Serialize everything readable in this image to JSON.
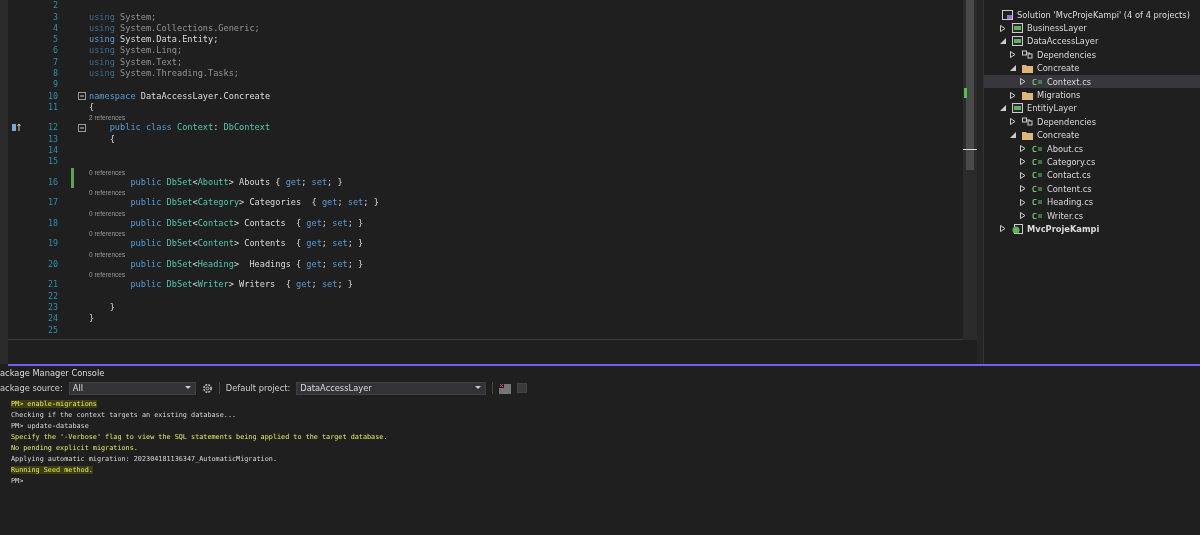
{
  "editor": {
    "lines": [
      {
        "number": "2"
      },
      {
        "number": "3",
        "dimmed": true,
        "changed": false,
        "tokens": [
          {
            "kind": "keyword",
            "text": "using"
          },
          {
            "kind": "plain",
            "text": " System;"
          }
        ]
      },
      {
        "number": "4",
        "dimmed": true,
        "changed": false,
        "tokens": [
          {
            "kind": "keyword",
            "text": "using"
          },
          {
            "kind": "plain",
            "text": " System.Collections.Generic;"
          }
        ]
      },
      {
        "number": "5",
        "dimmed": false,
        "changed": false,
        "tokens": [
          {
            "kind": "keyword",
            "text": "using"
          },
          {
            "kind": "plain",
            "text": " System.Data.Entity;"
          }
        ]
      },
      {
        "number": "6",
        "dimmed": true,
        "changed": false,
        "tokens": [
          {
            "kind": "keyword",
            "text": "using"
          },
          {
            "kind": "plain",
            "text": " System.Linq;"
          }
        ]
      },
      {
        "number": "7",
        "dimmed": true,
        "changed": false,
        "tokens": [
          {
            "kind": "keyword",
            "text": "using"
          },
          {
            "kind": "plain",
            "text": " System.Text;"
          }
        ]
      },
      {
        "number": "8",
        "dimmed": true,
        "changed": false,
        "tokens": [
          {
            "kind": "keyword",
            "text": "using"
          },
          {
            "kind": "plain",
            "text": " System.Threading.Tasks;"
          }
        ]
      },
      {
        "number": "9"
      },
      {
        "number": "10",
        "dimmed": false,
        "changed": false,
        "fold": true,
        "tokens": [
          {
            "kind": "keyword",
            "text": "namespace"
          },
          {
            "kind": "plain",
            "text": " DataAccessLayer.Concreate"
          }
        ]
      },
      {
        "number": "11",
        "dimmed": false,
        "changed": false,
        "tokens": [
          {
            "kind": "plain",
            "text": "{"
          }
        ]
      },
      {
        "number": "12",
        "dimmed": false,
        "changed": false,
        "fold": true,
        "override": true,
        "hint": "2 references",
        "tokens": [
          {
            "kind": "keyword",
            "text": "    public class"
          },
          {
            "kind": "type",
            "text": " Context"
          },
          {
            "kind": "plain",
            "text": ": "
          },
          {
            "kind": "type",
            "text": "DbContext"
          }
        ]
      },
      {
        "number": "13",
        "dimmed": false,
        "changed": false,
        "tokens": [
          {
            "kind": "plain",
            "text": "    {"
          }
        ]
      },
      {
        "number": "14"
      },
      {
        "number": "15"
      },
      {
        "number": "16",
        "dimmed": false,
        "changed": true,
        "hint": "0 references",
        "tokens": [
          {
            "kind": "keyword",
            "text": "        public"
          },
          {
            "kind": "type",
            "text": " DbSet"
          },
          {
            "kind": "plain",
            "text": "<"
          },
          {
            "kind": "type",
            "text": "Aboutt"
          },
          {
            "kind": "plain",
            "text": "> Abouts { "
          },
          {
            "kind": "keyword",
            "text": "get"
          },
          {
            "kind": "plain",
            "text": "; "
          },
          {
            "kind": "keyword",
            "text": "set"
          },
          {
            "kind": "plain",
            "text": "; }"
          }
        ]
      },
      {
        "number": "17",
        "dimmed": false,
        "changed": false,
        "hint": "0 references",
        "tokens": [
          {
            "kind": "keyword",
            "text": "        public"
          },
          {
            "kind": "type",
            "text": " DbSet"
          },
          {
            "kind": "plain",
            "text": "<"
          },
          {
            "kind": "type",
            "text": "Category"
          },
          {
            "kind": "plain",
            "text": "> Categories  { "
          },
          {
            "kind": "keyword",
            "text": "get"
          },
          {
            "kind": "plain",
            "text": "; "
          },
          {
            "kind": "keyword",
            "text": "set"
          },
          {
            "kind": "plain",
            "text": "; }"
          }
        ]
      },
      {
        "number": "18",
        "dimmed": false,
        "changed": false,
        "hint": "0 references",
        "tokens": [
          {
            "kind": "keyword",
            "text": "        public"
          },
          {
            "kind": "type",
            "text": " DbSet"
          },
          {
            "kind": "plain",
            "text": "<"
          },
          {
            "kind": "type",
            "text": "Contact"
          },
          {
            "kind": "plain",
            "text": "> Contacts  { "
          },
          {
            "kind": "keyword",
            "text": "get"
          },
          {
            "kind": "plain",
            "text": "; "
          },
          {
            "kind": "keyword",
            "text": "set"
          },
          {
            "kind": "plain",
            "text": "; }"
          }
        ]
      },
      {
        "number": "19",
        "dimmed": false,
        "changed": false,
        "hint": "0 references",
        "tokens": [
          {
            "kind": "keyword",
            "text": "        public"
          },
          {
            "kind": "type",
            "text": " DbSet"
          },
          {
            "kind": "plain",
            "text": "<"
          },
          {
            "kind": "type",
            "text": "Content"
          },
          {
            "kind": "plain",
            "text": "> Contents  { "
          },
          {
            "kind": "keyword",
            "text": "get"
          },
          {
            "kind": "plain",
            "text": "; "
          },
          {
            "kind": "keyword",
            "text": "set"
          },
          {
            "kind": "plain",
            "text": "; }"
          }
        ]
      },
      {
        "number": "20",
        "dimmed": false,
        "changed": false,
        "hint": "0 references",
        "tokens": [
          {
            "kind": "keyword",
            "text": "        public"
          },
          {
            "kind": "type",
            "text": " DbSet"
          },
          {
            "kind": "plain",
            "text": "<"
          },
          {
            "kind": "type",
            "text": "Heading"
          },
          {
            "kind": "plain",
            "text": ">  Headings { "
          },
          {
            "kind": "keyword",
            "text": "get"
          },
          {
            "kind": "plain",
            "text": "; "
          },
          {
            "kind": "keyword",
            "text": "set"
          },
          {
            "kind": "plain",
            "text": "; }"
          }
        ]
      },
      {
        "number": "21",
        "dimmed": false,
        "changed": false,
        "hint": "0 references",
        "tokens": [
          {
            "kind": "keyword",
            "text": "        public"
          },
          {
            "kind": "type",
            "text": " DbSet"
          },
          {
            "kind": "plain",
            "text": "<"
          },
          {
            "kind": "type",
            "text": "Writer"
          },
          {
            "kind": "plain",
            "text": "> Writers  { "
          },
          {
            "kind": "keyword",
            "text": "get"
          },
          {
            "kind": "plain",
            "text": "; "
          },
          {
            "kind": "keyword",
            "text": "set"
          },
          {
            "kind": "plain",
            "text": "; }"
          }
        ]
      },
      {
        "number": "22"
      },
      {
        "number": "23",
        "dimmed": false,
        "changed": false,
        "tokens": [
          {
            "kind": "plain",
            "text": "    }"
          }
        ]
      },
      {
        "number": "24",
        "dimmed": false,
        "changed": false,
        "tokens": [
          {
            "kind": "plain",
            "text": "}"
          }
        ]
      },
      {
        "number": "25"
      }
    ]
  },
  "solution_explorer": {
    "items": [
      {
        "kind": "solution",
        "label": "Solution 'MvcProjeKampi' (4 of 4 projects)",
        "selected": false,
        "bold": false,
        "children": [
          {
            "kind": "project",
            "label": "BusinessLayer",
            "expanded": false,
            "selected": false,
            "bold": false
          },
          {
            "kind": "project",
            "label": "DataAccessLayer",
            "expanded": true,
            "selected": false,
            "bold": false,
            "children": [
              {
                "kind": "dependencies",
                "label": "Dependencies",
                "expanded": false,
                "selected": false,
                "bold": false
              },
              {
                "kind": "folder",
                "label": "Concreate",
                "expanded": true,
                "selected": false,
                "bold": false,
                "children": [
                  {
                    "kind": "file",
                    "label": "Context.cs",
                    "expanded": false,
                    "selected": true,
                    "bold": false
                  }
                ]
              },
              {
                "kind": "folder",
                "label": "Migrations",
                "expanded": false,
                "selected": false,
                "bold": false
              }
            ]
          },
          {
            "kind": "project",
            "label": "EntitiyLayer",
            "expanded": true,
            "selected": false,
            "bold": false,
            "children": [
              {
                "kind": "dependencies",
                "label": "Dependencies",
                "expanded": false,
                "selected": false,
                "bold": false
              },
              {
                "kind": "folder",
                "label": "Concreate",
                "expanded": true,
                "selected": false,
                "bold": false,
                "children": [
                  {
                    "kind": "file",
                    "label": "About.cs",
                    "expanded": false,
                    "selected": false,
                    "bold": false
                  },
                  {
                    "kind": "file",
                    "label": "Category.cs",
                    "expanded": false,
                    "selected": false,
                    "bold": false
                  },
                  {
                    "kind": "file",
                    "label": "Contact.cs",
                    "expanded": false,
                    "selected": false,
                    "bold": false
                  },
                  {
                    "kind": "file",
                    "label": "Content.cs",
                    "expanded": false,
                    "selected": false,
                    "bold": false
                  },
                  {
                    "kind": "file",
                    "label": "Heading.cs",
                    "expanded": false,
                    "selected": false,
                    "bold": false
                  },
                  {
                    "kind": "file",
                    "label": "Writer.cs",
                    "expanded": false,
                    "selected": false,
                    "bold": false
                  }
                ]
              }
            ]
          },
          {
            "kind": "webproject",
            "label": "MvcProjeKampi",
            "expanded": false,
            "selected": false,
            "bold": true
          }
        ]
      }
    ]
  },
  "console": {
    "title": "ackage Manager Console",
    "source_label": "ackage source:",
    "source_value": "All",
    "project_label": "Default project:",
    "project_value": "DataAccessLayer",
    "lines": [
      {
        "kind": "warning",
        "marked": true,
        "text": "PM> enable-migrations"
      },
      {
        "kind": "normal",
        "marked": false,
        "text": "Checking if the context targets an existing database..."
      },
      {
        "kind": "normal",
        "marked": false,
        "text": "PM> update-database"
      },
      {
        "kind": "warning",
        "marked": false,
        "text": "Specify the '-Verbose' flag to view the SQL statements being applied to the target database."
      },
      {
        "kind": "warning",
        "marked": false,
        "text": "No pending explicit migrations."
      },
      {
        "kind": "normal",
        "marked": false,
        "text": "Applying automatic migration: 202304181136347_AutomaticMigration."
      },
      {
        "kind": "warning",
        "marked": true,
        "text": "Running Seed method."
      },
      {
        "kind": "normal",
        "marked": false,
        "text": "PM>"
      }
    ]
  }
}
